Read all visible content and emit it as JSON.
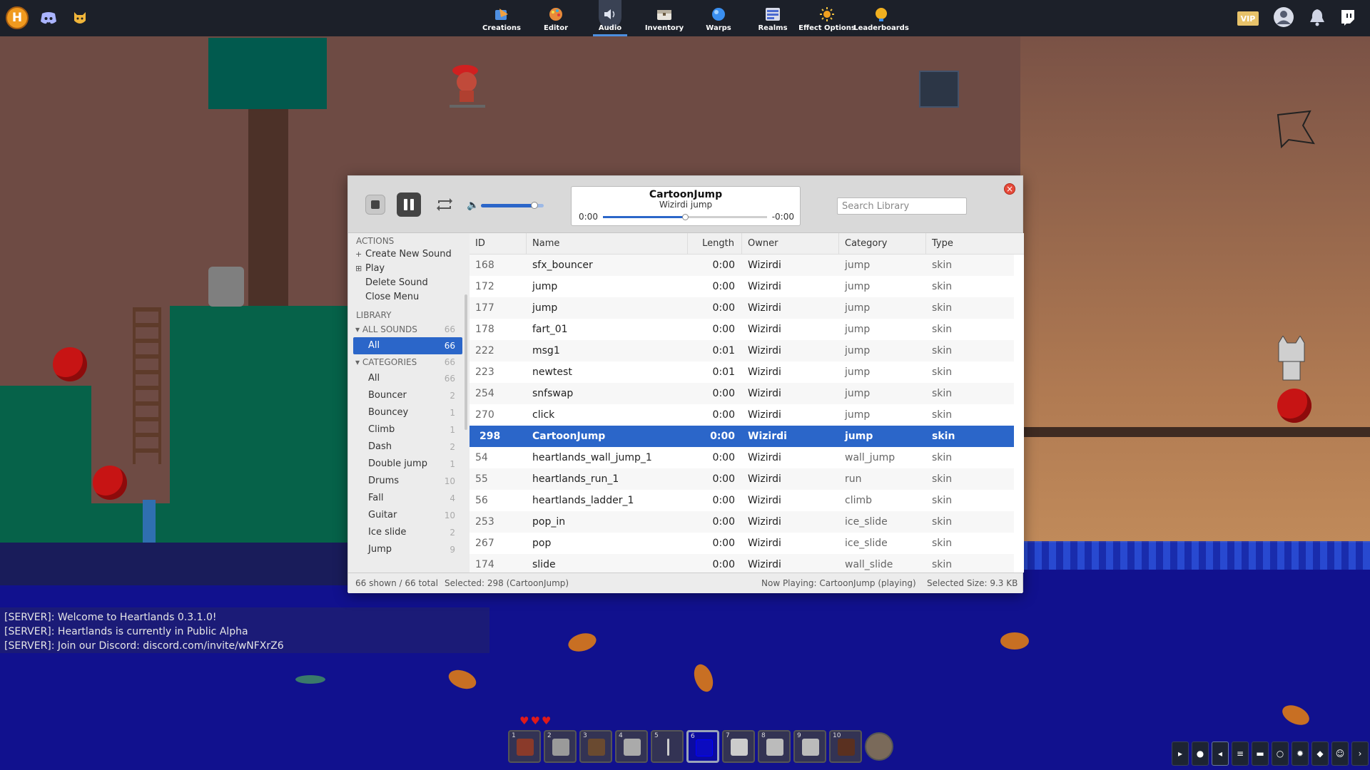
{
  "nav": {
    "items": [
      {
        "label": "Creations",
        "icon": "creations-icon"
      },
      {
        "label": "Editor",
        "icon": "palette-icon"
      },
      {
        "label": "Audio",
        "icon": "speaker-icon"
      },
      {
        "label": "Inventory",
        "icon": "chest-icon"
      },
      {
        "label": "Warps",
        "icon": "orb-icon"
      },
      {
        "label": "Realms",
        "icon": "realms-icon"
      },
      {
        "label": "Effect Options",
        "icon": "sun-icon"
      },
      {
        "label": "Leaderboards",
        "icon": "trophy-icon"
      }
    ],
    "active": "Audio",
    "vip_label": "VIP"
  },
  "player": {
    "title": "CartoonJump",
    "subtitle": "Wizirdi jump",
    "time_elapsed": "0:00",
    "time_remaining": "-0:00",
    "progress": 0.5,
    "volume": 0.85,
    "search_placeholder": "Search Library"
  },
  "sidebar": {
    "actions_header": "ACTIONS",
    "actions": [
      {
        "glyph": "+",
        "label": "Create New Sound"
      },
      {
        "glyph": "⊞",
        "label": "Play"
      },
      {
        "glyph": "",
        "label": "Delete Sound"
      },
      {
        "glyph": "",
        "label": "Close Menu"
      }
    ],
    "library_header": "LIBRARY",
    "all_sounds": {
      "label": "ALL SOUNDS",
      "count": "66"
    },
    "all_item": {
      "label": "All",
      "count": "66"
    },
    "categories": {
      "label": "CATEGORIES",
      "count": "66"
    },
    "category_items": [
      {
        "label": "All",
        "count": "66"
      },
      {
        "label": "Bouncer",
        "count": "2"
      },
      {
        "label": "Bouncey",
        "count": "1"
      },
      {
        "label": "Climb",
        "count": "1"
      },
      {
        "label": "Dash",
        "count": "2"
      },
      {
        "label": "Double jump",
        "count": "1"
      },
      {
        "label": "Drums",
        "count": "10"
      },
      {
        "label": "Fall",
        "count": "4"
      },
      {
        "label": "Guitar",
        "count": "10"
      },
      {
        "label": "Ice slide",
        "count": "2"
      },
      {
        "label": "Jump",
        "count": "9"
      }
    ]
  },
  "table": {
    "columns": [
      "ID",
      "Name",
      "Length",
      "Owner",
      "Category",
      "Type"
    ],
    "rows": [
      {
        "id": "168",
        "name": "sfx_bouncer",
        "length": "0:00",
        "owner": "Wizirdi",
        "category": "jump",
        "type": "skin"
      },
      {
        "id": "172",
        "name": "jump",
        "length": "0:00",
        "owner": "Wizirdi",
        "category": "jump",
        "type": "skin"
      },
      {
        "id": "177",
        "name": "jump",
        "length": "0:00",
        "owner": "Wizirdi",
        "category": "jump",
        "type": "skin"
      },
      {
        "id": "178",
        "name": "fart_01",
        "length": "0:00",
        "owner": "Wizirdi",
        "category": "jump",
        "type": "skin"
      },
      {
        "id": "222",
        "name": "msg1",
        "length": "0:01",
        "owner": "Wizirdi",
        "category": "jump",
        "type": "skin"
      },
      {
        "id": "223",
        "name": "newtest",
        "length": "0:01",
        "owner": "Wizirdi",
        "category": "jump",
        "type": "skin"
      },
      {
        "id": "254",
        "name": "snfswap",
        "length": "0:00",
        "owner": "Wizirdi",
        "category": "jump",
        "type": "skin"
      },
      {
        "id": "270",
        "name": "click",
        "length": "0:00",
        "owner": "Wizirdi",
        "category": "jump",
        "type": "skin"
      },
      {
        "id": "298",
        "name": "CartoonJump",
        "length": "0:00",
        "owner": "Wizirdi",
        "category": "jump",
        "type": "skin",
        "selected": true
      },
      {
        "id": "54",
        "name": "heartlands_wall_jump_1",
        "length": "0:00",
        "owner": "Wizirdi",
        "category": "wall_jump",
        "type": "skin"
      },
      {
        "id": "55",
        "name": "heartlands_run_1",
        "length": "0:00",
        "owner": "Wizirdi",
        "category": "run",
        "type": "skin"
      },
      {
        "id": "56",
        "name": "heartlands_ladder_1",
        "length": "0:00",
        "owner": "Wizirdi",
        "category": "climb",
        "type": "skin"
      },
      {
        "id": "253",
        "name": "pop_in",
        "length": "0:00",
        "owner": "Wizirdi",
        "category": "ice_slide",
        "type": "skin"
      },
      {
        "id": "267",
        "name": "pop",
        "length": "0:00",
        "owner": "Wizirdi",
        "category": "ice_slide",
        "type": "skin"
      },
      {
        "id": "174",
        "name": "slide",
        "length": "0:00",
        "owner": "Wizirdi",
        "category": "wall_slide",
        "type": "skin"
      }
    ]
  },
  "status": {
    "shown": "66 shown / 66 total",
    "selected": "Selected: 298 (CartoonJump)",
    "now_playing": "Now Playing: CartoonJump (playing)",
    "size": "Selected Size: 9.3 KB"
  },
  "chat": [
    "[SERVER]: Welcome to Heartlands 0.3.1.0!",
    "[SERVER]: Heartlands is currently in Public Alpha",
    "[SERVER]: Join our Discord: discord.com/invite/wNFXrZ6"
  ],
  "hotbar": {
    "slots": [
      "1",
      "2",
      "3",
      "4",
      "5",
      "6",
      "7",
      "8",
      "9",
      "10"
    ],
    "selected": "6",
    "hearts": 3
  },
  "colors": {
    "accent": "#2b66c9",
    "topbar": "#1c2029",
    "water": "#11118e"
  }
}
